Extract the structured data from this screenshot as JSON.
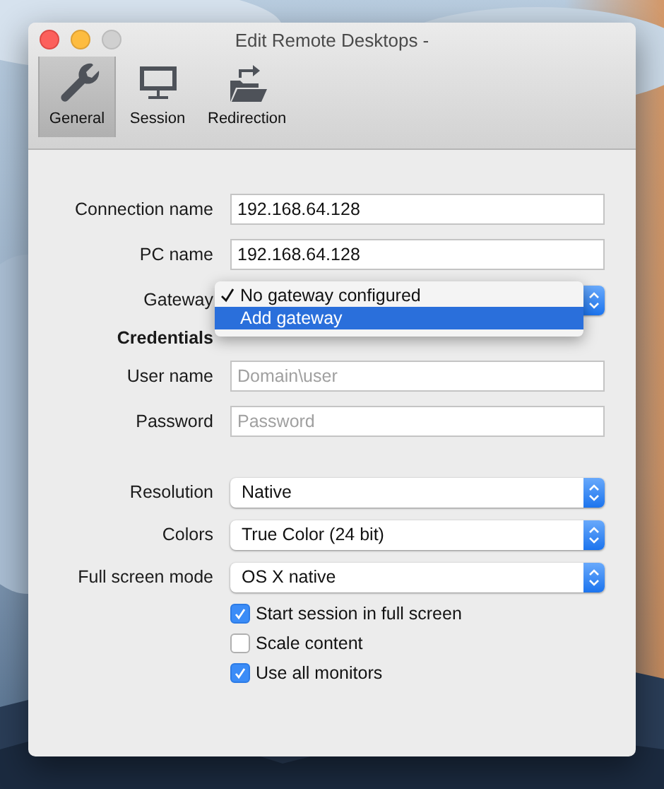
{
  "window": {
    "title": "Edit Remote Desktops -"
  },
  "tabs": [
    {
      "label": "General",
      "selected": true,
      "kind": "wrench"
    },
    {
      "label": "Session",
      "selected": false,
      "kind": "monitor"
    },
    {
      "label": "Redirection",
      "selected": false,
      "kind": "folder"
    }
  ],
  "sections": [
    {
      "rows": [
        {
          "kind": "text",
          "label": "Connection name",
          "value": "192.168.64.128"
        },
        {
          "kind": "text",
          "label": "PC name",
          "value": "192.168.64.128"
        },
        {
          "kind": "popup",
          "label": "Gateway",
          "open": true,
          "menu": [
            {
              "label": "No gateway configured",
              "checked": true,
              "selected": false
            },
            {
              "label": "Add gateway",
              "checked": false,
              "selected": true
            }
          ]
        },
        {
          "kind": "heading",
          "label": "Credentials"
        },
        {
          "kind": "text",
          "label": "User name",
          "placeholder": "Domain\\user"
        },
        {
          "kind": "text",
          "label": "Password",
          "placeholder": "Password"
        }
      ]
    },
    {
      "rows": [
        {
          "kind": "popup",
          "label": "Resolution",
          "open": false,
          "value": "Native"
        },
        {
          "kind": "popup",
          "label": "Colors",
          "open": false,
          "value": "True Color (24 bit)"
        },
        {
          "kind": "popup",
          "label": "Full screen mode",
          "open": false,
          "value": "OS X native"
        },
        {
          "kind": "checkbox",
          "label": "Start session in full screen",
          "checked": true
        },
        {
          "kind": "checkbox",
          "label": "Scale content",
          "checked": false
        },
        {
          "kind": "checkbox",
          "label": "Use all monitors",
          "checked": true
        }
      ]
    }
  ]
}
